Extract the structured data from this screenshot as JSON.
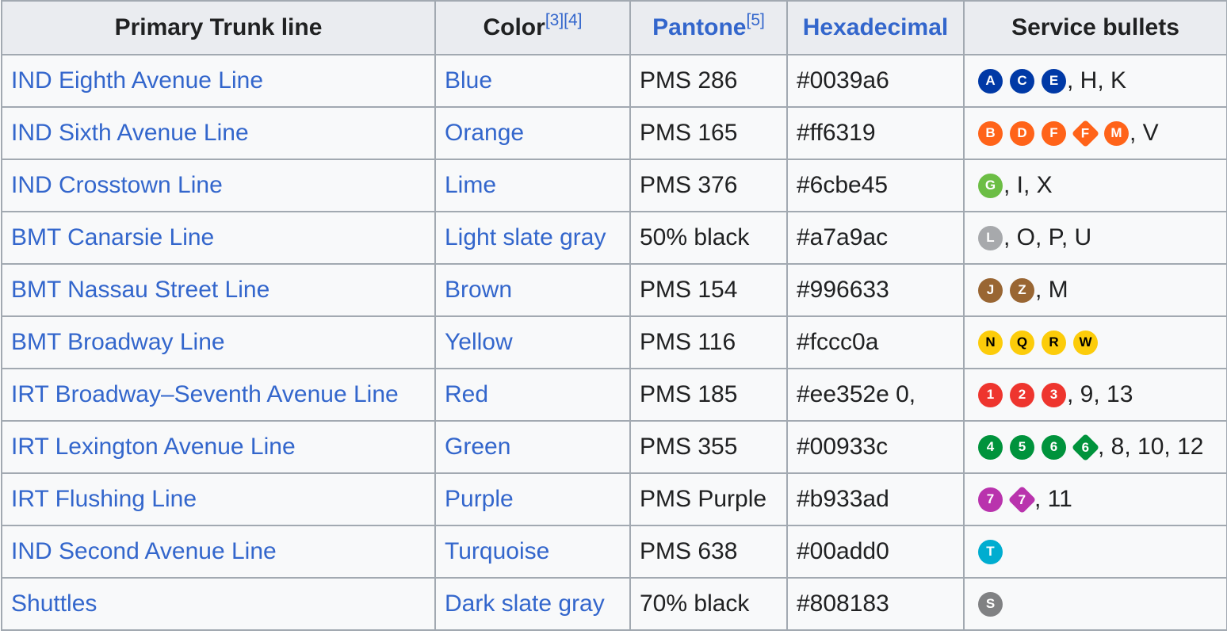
{
  "headers": {
    "line": "Primary Trunk line",
    "color": "Color",
    "color_refs": "[3][4]",
    "pantone": "Pantone",
    "pantone_ref": "[5]",
    "hex": "Hexadecimal",
    "bullets": "Service bullets"
  },
  "rows": [
    {
      "line": "IND Eighth Avenue Line",
      "color": "Blue",
      "pantone": "PMS 286",
      "hex": "#0039a6",
      "hex_color": "#0039a6",
      "bullets": [
        {
          "label": "A",
          "shape": "circle"
        },
        {
          "label": "C",
          "shape": "circle"
        },
        {
          "label": "E",
          "shape": "circle"
        }
      ],
      "extra": ", H, K"
    },
    {
      "line": "IND Sixth Avenue Line",
      "color": "Orange",
      "pantone": "PMS 165",
      "hex": "#ff6319",
      "hex_color": "#ff6319",
      "bullets": [
        {
          "label": "B",
          "shape": "circle"
        },
        {
          "label": "D",
          "shape": "circle"
        },
        {
          "label": "F",
          "shape": "circle"
        },
        {
          "label": "F",
          "shape": "diamond"
        },
        {
          "label": "M",
          "shape": "circle"
        }
      ],
      "extra": ", V"
    },
    {
      "line": "IND Crosstown Line",
      "color": "Lime",
      "pantone": "PMS 376",
      "hex": "#6cbe45",
      "hex_color": "#6cbe45",
      "bullets": [
        {
          "label": "G",
          "shape": "circle"
        }
      ],
      "extra": ", I, X"
    },
    {
      "line": "BMT Canarsie Line",
      "color": "Light slate gray",
      "pantone": "50% black",
      "hex": "#a7a9ac",
      "hex_color": "#a7a9ac",
      "bullets": [
        {
          "label": "L",
          "shape": "circle"
        }
      ],
      "extra": ", O, P, U"
    },
    {
      "line": "BMT Nassau Street Line",
      "color": "Brown",
      "pantone": "PMS 154",
      "hex": "#996633",
      "hex_color": "#996633",
      "bullets": [
        {
          "label": "J",
          "shape": "circle"
        },
        {
          "label": "Z",
          "shape": "circle"
        }
      ],
      "extra": ", M"
    },
    {
      "line": "BMT Broadway Line",
      "color": "Yellow",
      "pantone": "PMS 116",
      "hex": "#fccc0a",
      "hex_color": "#fccc0a",
      "dark_text": true,
      "bullets": [
        {
          "label": "N",
          "shape": "circle"
        },
        {
          "label": "Q",
          "shape": "circle"
        },
        {
          "label": "R",
          "shape": "circle"
        },
        {
          "label": "W",
          "shape": "circle"
        }
      ],
      "extra": ""
    },
    {
      "line": "IRT Broadway–Seventh Avenue Line",
      "color": "Red",
      "pantone": "PMS 185",
      "hex": "#ee352e 0,",
      "hex_color": "#ee352e",
      "bullets": [
        {
          "label": "1",
          "shape": "circle"
        },
        {
          "label": "2",
          "shape": "circle"
        },
        {
          "label": "3",
          "shape": "circle"
        }
      ],
      "extra": ", 9, 13"
    },
    {
      "line": "IRT Lexington Avenue Line",
      "color": "Green",
      "pantone": "PMS 355",
      "hex": "#00933c",
      "hex_color": "#00933c",
      "bullets": [
        {
          "label": "4",
          "shape": "circle"
        },
        {
          "label": "5",
          "shape": "circle"
        },
        {
          "label": "6",
          "shape": "circle"
        },
        {
          "label": "6",
          "shape": "diamond"
        }
      ],
      "extra": ", 8, 10, 12"
    },
    {
      "line": "IRT Flushing Line",
      "color": "Purple",
      "pantone": "PMS Purple",
      "hex": "#b933ad",
      "hex_color": "#b933ad",
      "bullets": [
        {
          "label": "7",
          "shape": "circle"
        },
        {
          "label": "7",
          "shape": "diamond"
        }
      ],
      "extra": ", 11"
    },
    {
      "line": "IND Second Avenue Line",
      "color": "Turquoise",
      "pantone": "PMS 638",
      "hex": "#00add0",
      "hex_color": "#00add0",
      "bullets": [
        {
          "label": "T",
          "shape": "circle"
        }
      ],
      "extra": ""
    },
    {
      "line": "Shuttles",
      "color": "Dark slate gray",
      "pantone": "70% black",
      "hex": "#808183",
      "hex_color": "#808183",
      "bullets": [
        {
          "label": "S",
          "shape": "circle"
        }
      ],
      "extra": ""
    }
  ]
}
